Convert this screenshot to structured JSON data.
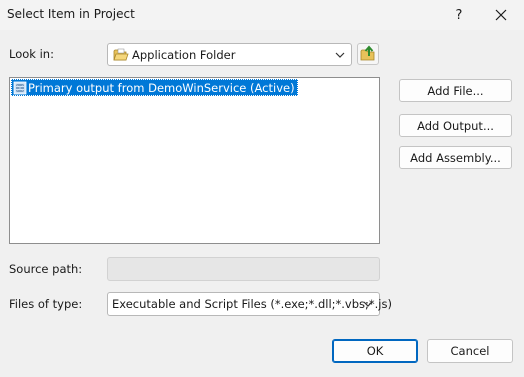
{
  "window": {
    "title": "Select Item in Project",
    "help_label": "?",
    "close_icon": "close-icon"
  },
  "look_in": {
    "label": "Look in:",
    "value": "Application Folder",
    "folder_icon": "folder-icon",
    "up_icon": "folder-up-icon"
  },
  "items": [
    {
      "label": "Primary output from DemoWinService (Active)",
      "icon": "project-output-icon",
      "selected": true
    }
  ],
  "side_buttons": {
    "add_file": "Add File...",
    "add_output": "Add Output...",
    "add_assembly": "Add Assembly..."
  },
  "source_path": {
    "label": "Source path:",
    "value": ""
  },
  "files_of_type": {
    "label": "Files of type:",
    "value": "Executable and Script Files (*.exe;*.dll;*.vbs;*.js)"
  },
  "footer": {
    "ok": "OK",
    "cancel": "Cancel"
  },
  "colors": {
    "selection": "#0078d7",
    "dialog_bg": "#f0f0f0",
    "default_button_border": "#0067c0"
  }
}
